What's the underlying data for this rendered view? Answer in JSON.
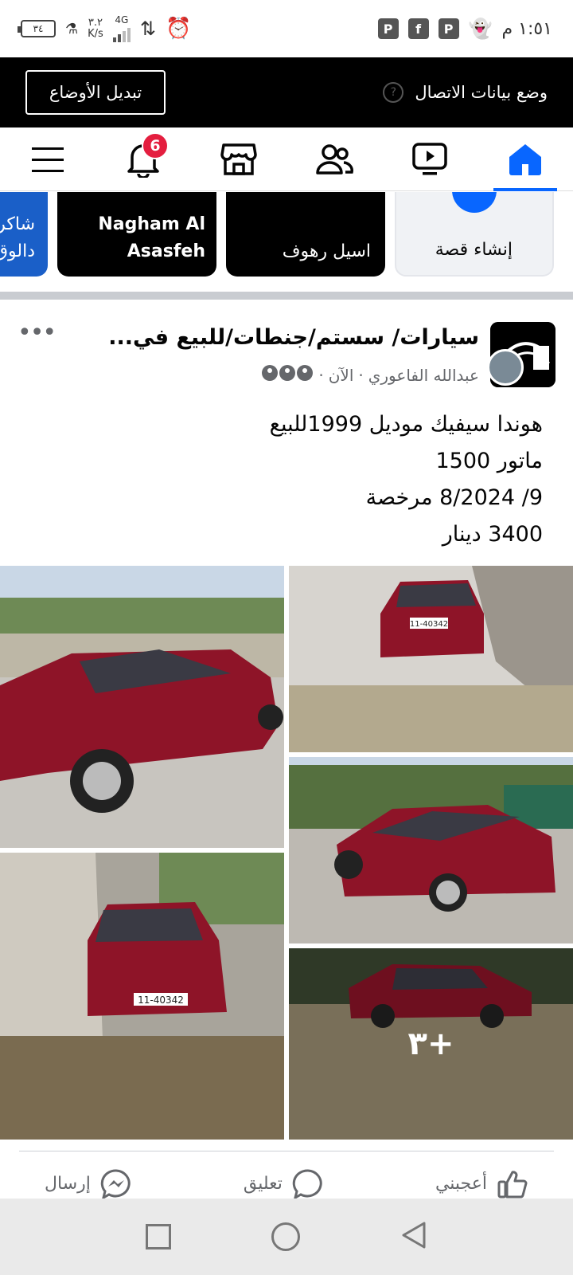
{
  "status_bar": {
    "time": "١:٥١ م",
    "battery": "٣٤",
    "speed_value": "٣.٢",
    "speed_unit": "K/s",
    "network": "4G",
    "icons": [
      "alarm-icon",
      "data-arrows-icon",
      "signal-icon",
      "wifi-icon",
      "battery-icon",
      "snapchat-icon",
      "app-icon",
      "facebook-icon",
      "app-icon"
    ]
  },
  "data_mode_bar": {
    "title": "وضع بيانات الاتصال",
    "switch_button": "تبديل الأوضاع"
  },
  "nav": {
    "notifications_count": "6",
    "items": [
      "home-icon",
      "watch-icon",
      "friends-icon",
      "marketplace-icon",
      "notifications-icon",
      "menu-icon"
    ],
    "accent": "#0866ff"
  },
  "stories": {
    "create_label": "إنشاء قصة",
    "items": [
      {
        "name": "اسيل رهوف"
      },
      {
        "name": "Nagham Al Asasfeh"
      },
      {
        "name": "شاكر دالوق"
      }
    ]
  },
  "post": {
    "group_name": "سيارات/ سستم/جنطات/للبيع في...",
    "author": "عبدالله الفاعوري",
    "time": "الآن",
    "lines": [
      "هوندا سيفيك موديل 1999للبيع",
      "ماتور 1500",
      "9/ 8/2024 مرخصة",
      "3400 دينار"
    ],
    "more_photos": "٣+",
    "plates": [
      "11-40342",
      "11-40342"
    ]
  },
  "actions": {
    "like": "أعجبني",
    "comment": "تعليق",
    "send": "إرسال"
  }
}
